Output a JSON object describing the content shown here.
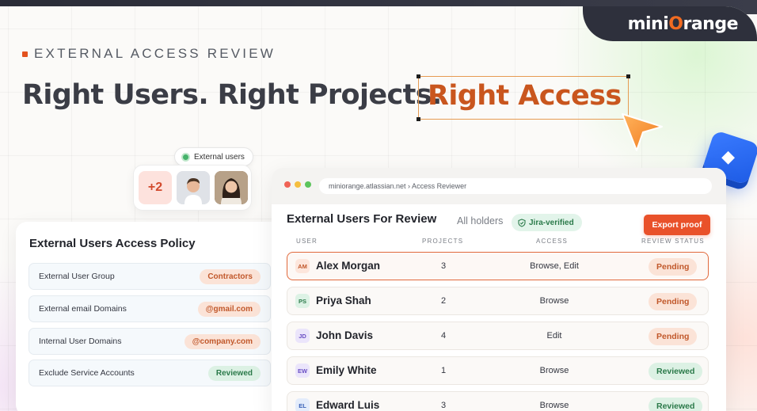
{
  "brand": {
    "logo_prefix": "mini",
    "logo_o": "O",
    "logo_suffix": "range",
    "accent": "#f26b21"
  },
  "hero": {
    "eyebrow": "EXTERNAL ACCESS REVIEW",
    "headline": "Right Users. Right Projects.",
    "highlight": "Right Access"
  },
  "external_users": {
    "pill_label": "External users",
    "extra_count": "+2"
  },
  "policy": {
    "title": "External Users Access Policy",
    "rows": [
      {
        "label": "External User Group",
        "value": "Contractors",
        "tone": "orange"
      },
      {
        "label": "External email Domains",
        "value": "@gmail.com",
        "tone": "orange"
      },
      {
        "label": "Internal User Domains",
        "value": "@company.com",
        "tone": "orange"
      },
      {
        "label": "Exclude Service Accounts",
        "value": "Reviewed",
        "tone": "green"
      }
    ]
  },
  "review": {
    "url": "miniorange.atlassian.net › Access Reviewer",
    "title": "External Users For Review",
    "subtitle": "All holders",
    "verified_label": "Jira-verified",
    "export_label": "Export proof",
    "columns": [
      "USER",
      "PROJECTS",
      "ACCESS",
      "REVIEW STATUS"
    ],
    "rows": [
      {
        "initials": "AM",
        "name": "Alex Morgan",
        "projects": "3",
        "access": "Browse, Edit",
        "status": "Pending",
        "tone": "pending",
        "ini_bg": "#fde6dc",
        "ini_fg": "#c1582b"
      },
      {
        "initials": "PS",
        "name": "Priya Shah",
        "projects": "2",
        "access": "Browse",
        "status": "Pending",
        "tone": "pending",
        "ini_bg": "#ddf2e5",
        "ini_fg": "#2b7a4a"
      },
      {
        "initials": "JD",
        "name": "John Davis",
        "projects": "4",
        "access": "Edit",
        "status": "Pending",
        "tone": "pending",
        "ini_bg": "#ebe5fb",
        "ini_fg": "#6a4fc4"
      },
      {
        "initials": "EW",
        "name": "Emily White",
        "projects": "1",
        "access": "Browse",
        "status": "Reviewed",
        "tone": "reviewed",
        "ini_bg": "#ebe5fb",
        "ini_fg": "#6a4fc4"
      },
      {
        "initials": "EL",
        "name": "Edward Luis",
        "projects": "3",
        "access": "Browse",
        "status": "Reviewed",
        "tone": "reviewed",
        "ini_bg": "#e3ecfb",
        "ini_fg": "#3a62b8"
      }
    ]
  }
}
